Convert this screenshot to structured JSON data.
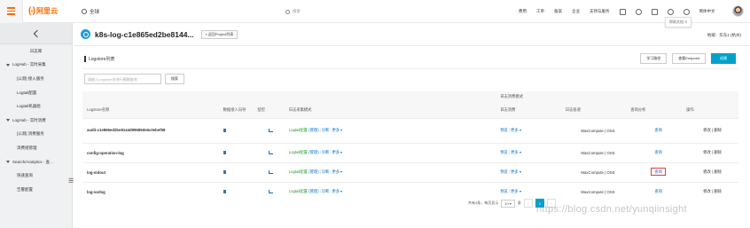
{
  "topbar": {
    "logo_text": "阿里云",
    "region_label": "全球",
    "search_placeholder": "搜索",
    "links": [
      "费用",
      "工单",
      "备案",
      "企业",
      "支持与服务"
    ],
    "lang": "简体中文",
    "tooltip": "帮助文档"
  },
  "sidebar": {
    "overview": "日志库",
    "items": [
      {
        "type": "group",
        "label": "LogHub - 实时采集"
      },
      {
        "type": "sub",
        "label": "[公测] 接入服务"
      },
      {
        "type": "sub",
        "label": "Logtail配置"
      },
      {
        "type": "sub",
        "label": "Logtail机器组"
      },
      {
        "type": "group",
        "label": "LogHub - 实时消费"
      },
      {
        "type": "sub",
        "label": "[公测] 消费服务"
      },
      {
        "type": "sub",
        "label": "消费组管理"
      },
      {
        "type": "group",
        "label": "Search/Analytics - 查..."
      },
      {
        "type": "sub",
        "label": "快速查询"
      },
      {
        "type": "sub",
        "label": "告警配置"
      }
    ]
  },
  "header": {
    "project_name": "k8s-log-c1e865ed2be8144...",
    "back_label": "« 返回Project列表",
    "region_text": "地域：华东1 (杭州)"
  },
  "panel": {
    "title": "Logstore列表",
    "learn_btn": "学习路径",
    "endpoint_btn": "查看Endpoint",
    "create_btn": "创建",
    "search_placeholder": "请输入Logstore名进行模糊查询",
    "search_btn": "搜索"
  },
  "table": {
    "group_header": "日志消费模式",
    "headers": {
      "name": "Logstore名称",
      "source": "数据接入向导",
      "monitor": "监控",
      "mode": "日志采集模式",
      "consume": "日志消费",
      "ship": "日志投递",
      "query": "查询分析",
      "ops": "操作"
    },
    "rows": [
      {
        "name": "audit-c1e865ed2be8144d99589de6c0ebef58",
        "mode": "Logtail配置",
        "mode_manage": "管理",
        "consume": "预览",
        "ship": "MaxCompute | OSS",
        "query": "查询",
        "ops": "修改 | 删除"
      },
      {
        "name": "config-operation-log",
        "mode": "Logtail配置",
        "mode_manage": "管理",
        "consume": "预览",
        "ship": "MaxCompute | OSS",
        "query": "查询",
        "ops": "修改 | 删除"
      },
      {
        "name": "log-stdout",
        "mode": "Logtail配置",
        "mode_manage": "管理",
        "consume": "预览",
        "ship": "MaxCompute | OSS",
        "query": "查询",
        "ops": "修改 | 删除"
      },
      {
        "name": "log-varlog",
        "mode": "Logtail配置",
        "mode_manage": "管理",
        "consume": "预览",
        "ship": "MaxCompute | OSS",
        "query": "查询",
        "ops": "修改 | 删除"
      }
    ],
    "mode_extra": "诊断",
    "more": "更多"
  },
  "pagination": {
    "summary": "共有4条，每页显示",
    "page_size": "10",
    "unit": "条",
    "prev": "‹",
    "current": "1",
    "next": "›"
  },
  "watermark": "https://blog.csdn.net/yunqiinsight"
}
